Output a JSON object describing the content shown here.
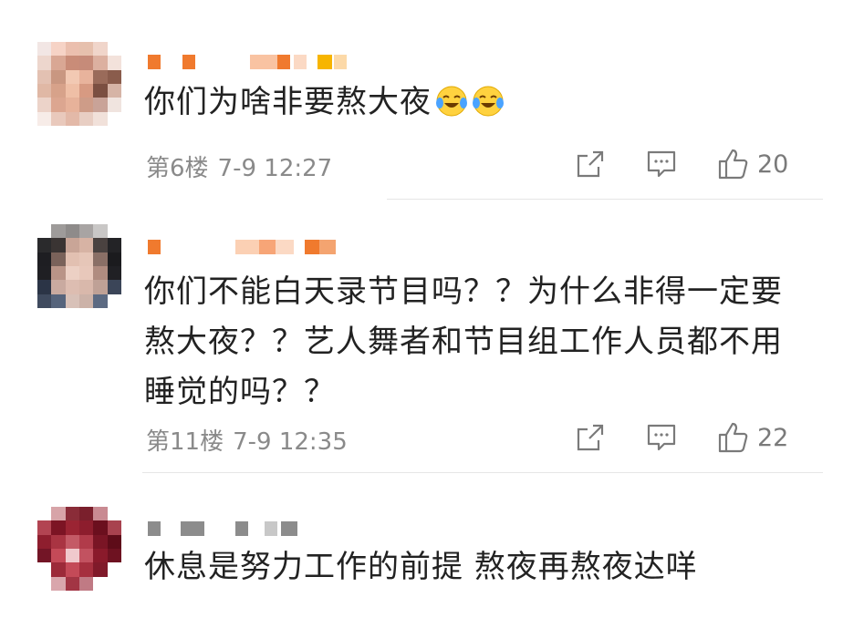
{
  "comments": [
    {
      "text": "你们为啥非要熬大夜",
      "emojis": [
        "laugh-cry-emoji",
        "laugh-cry-emoji"
      ],
      "floor": "第6楼",
      "time": "7-9 12:27",
      "likes": "20"
    },
    {
      "text": "你们不能白天录节目吗？？为什么非得一定要熬大夜？？艺人舞者和节目组工作人员都不用睡觉的吗？？",
      "floor": "第11楼",
      "time": "7-9 12:35",
      "likes": "22"
    },
    {
      "text": "休息是努力工作的前提 熬夜再熬夜达咩"
    }
  ],
  "icons": {
    "share": "share-icon",
    "comment": "comment-icon",
    "like": "thumbs-up-icon"
  },
  "colors": {
    "nickname_1": "#f07a2e",
    "nickname_2": "#f07a2e",
    "nickname_3": "#8c8c8c",
    "meta_text": "#8a8a8a",
    "icon_stroke": "#7a7a7a"
  }
}
